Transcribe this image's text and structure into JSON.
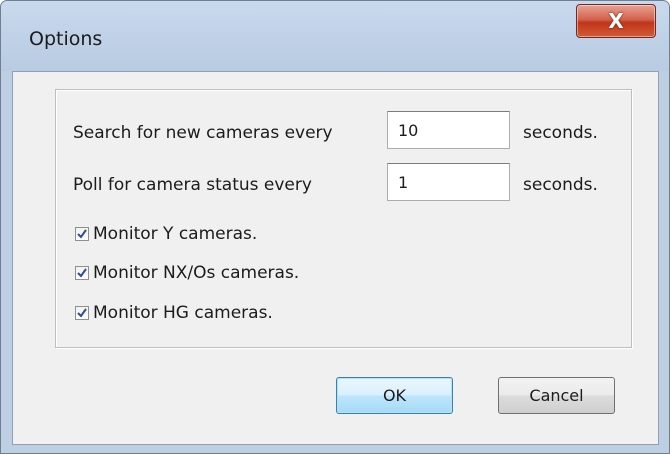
{
  "window": {
    "title": "Options",
    "close_label": "X"
  },
  "options": {
    "search": {
      "label": "Search for new cameras every",
      "value": "10",
      "unit": "seconds."
    },
    "poll": {
      "label": "Poll for camera status every",
      "value": "1",
      "unit": "seconds."
    },
    "checkboxes": [
      {
        "label": "Monitor Y cameras.",
        "checked": true
      },
      {
        "label": "Monitor NX/Os cameras.",
        "checked": true
      },
      {
        "label": "Monitor HG cameras.",
        "checked": true
      }
    ]
  },
  "buttons": {
    "ok_label": "OK",
    "cancel_label": "Cancel"
  },
  "colors": {
    "frame": "#bfcfe3",
    "client": "#f0f0f0",
    "close_button": "#c1361a",
    "default_button_border": "#3c7fb1",
    "checkmark": "#2e4c8f"
  }
}
